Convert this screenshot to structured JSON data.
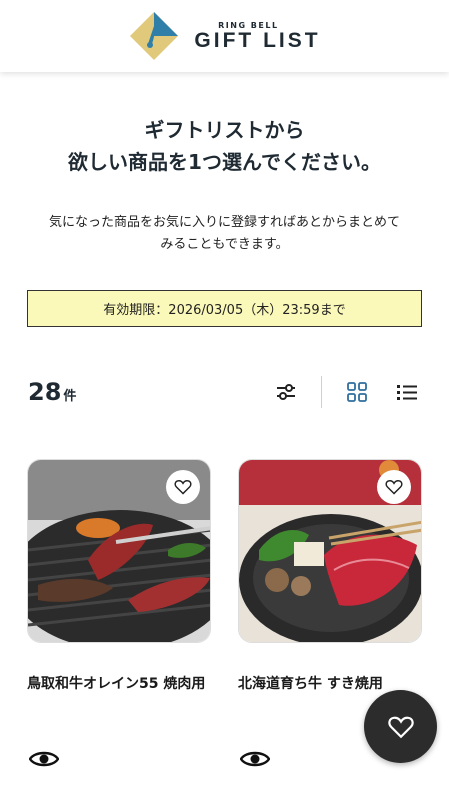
{
  "header": {
    "logo_small": "RING BELL",
    "logo_big": "GIFT LIST",
    "logo_colors": {
      "gold": "#e0c97a",
      "teal": "#2f7fa8"
    }
  },
  "intro": {
    "heading_line1": "ギフトリストから",
    "heading_line2": "欲しい商品を1つ選んでください。",
    "sub_line1": "気になった商品をお気に入りに登録すればあとからまとめて",
    "sub_line2": "みることもできます。"
  },
  "deadline": {
    "text": "有効期限：2026/03/05（木）23:59まで",
    "bg_color": "#fbf9b9"
  },
  "results": {
    "count": "28",
    "unit": "件"
  },
  "toolbar": {
    "filter_icon": "sliders-icon",
    "grid_icon": "grid-view-icon",
    "list_icon": "list-view-icon",
    "active_view": "grid",
    "accent": "#2f6f9f"
  },
  "products": [
    {
      "title": "鳥取和牛オレイン55 焼肉用",
      "image": "grilled-beef-photo"
    },
    {
      "title": "北海道育ち牛 すき焼用",
      "image": "sukiyaki-photo"
    }
  ],
  "fab": {
    "icon": "heart-icon"
  }
}
